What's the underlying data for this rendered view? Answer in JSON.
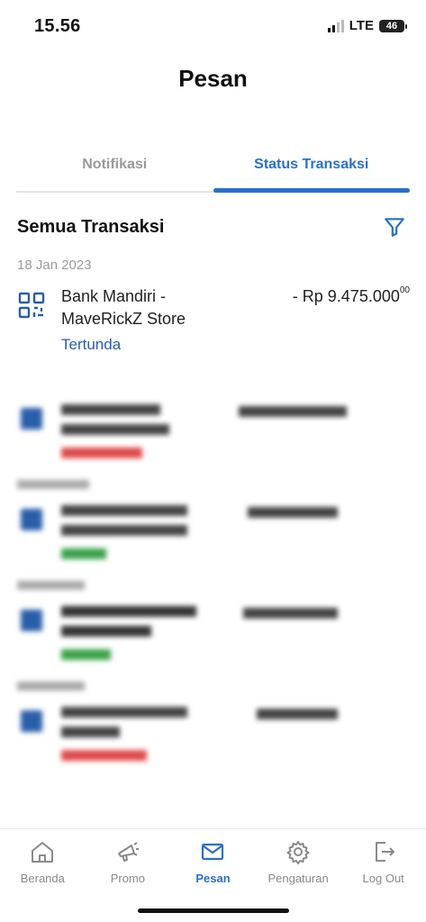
{
  "status_bar": {
    "time": "15.56",
    "network": "LTE",
    "battery": "46"
  },
  "header": {
    "title": "Pesan"
  },
  "tabs": [
    {
      "label": "Notifikasi",
      "active": false
    },
    {
      "label": "Status Transaksi",
      "active": true
    }
  ],
  "section": {
    "title": "Semua Transaksi",
    "filter_icon": "filter-icon"
  },
  "transactions": [
    {
      "date": "18 Jan 2023",
      "icon": "qr-code-icon",
      "name": "Bank Mandiri - MaveRickZ Store",
      "amount": "- Rp 9.475.000",
      "amount_cents": "00",
      "status": "Tertunda",
      "status_color": "#2a5ea8"
    }
  ],
  "colors": {
    "accent": "#2a6fd0",
    "pending": "#2a5ea8",
    "failed": "#e04a4a",
    "success": "#3aa34a"
  },
  "bottom_nav": [
    {
      "label": "Beranda",
      "icon": "home-icon",
      "active": false
    },
    {
      "label": "Promo",
      "icon": "megaphone-icon",
      "active": false
    },
    {
      "label": "Pesan",
      "icon": "mail-icon",
      "active": true
    },
    {
      "label": "Pengaturan",
      "icon": "gear-icon",
      "active": false
    },
    {
      "label": "Log Out",
      "icon": "logout-icon",
      "active": false
    }
  ]
}
